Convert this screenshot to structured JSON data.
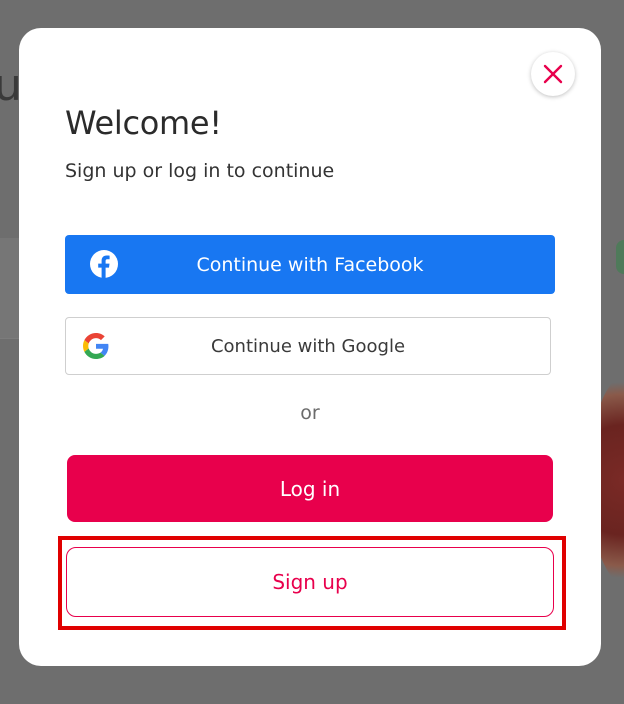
{
  "modal": {
    "title": "Welcome!",
    "subtitle": "Sign up or log in to continue",
    "facebook_button": "Continue with Facebook",
    "google_button": "Continue with Google",
    "divider_text": "or",
    "login_button": "Log in",
    "signup_button": "Sign up",
    "close_icon": "close-icon"
  },
  "colors": {
    "facebook_blue": "#1877f2",
    "brand_pink": "#e8004c",
    "highlight_red": "#e00000",
    "overlay": "#6e6e6e"
  },
  "icons": {
    "facebook": "facebook-icon",
    "google": "google-icon",
    "close": "close-icon"
  }
}
